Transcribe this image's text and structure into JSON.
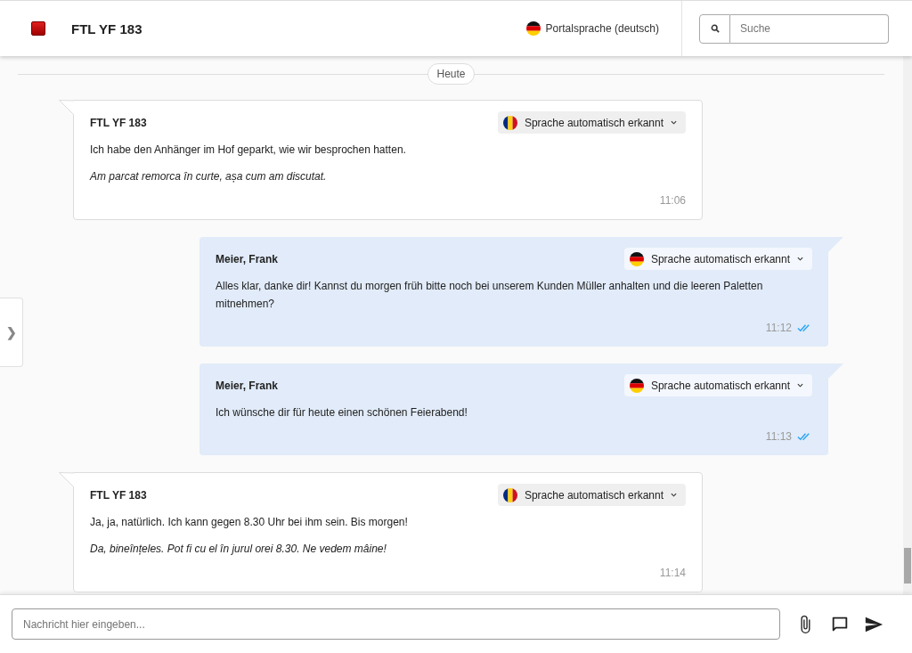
{
  "header": {
    "title": "FTL YF 183",
    "portal_language": {
      "label": "Portalsprache (deutsch)",
      "flag": {
        "kind": "de"
      }
    },
    "search": {
      "placeholder": "Suche"
    }
  },
  "date_divider": "Heute",
  "messages": [
    {
      "kind": "incoming",
      "sender": "FTL YF 183",
      "language": {
        "label": "Sprache automatisch erkannt",
        "flag": {
          "kind": "ro"
        }
      },
      "text": "Ich habe den Anhänger im Hof geparkt, wie wir besprochen hatten.",
      "translation": "Am parcat remorca în curte, așa cum am discutat.",
      "time": "11:06"
    },
    {
      "kind": "outgoing",
      "sender": "Meier, Frank",
      "language": {
        "label": "Sprache automatisch erkannt",
        "flag": {
          "kind": "de"
        }
      },
      "text": "Alles klar, danke dir! Kannst du morgen früh bitte noch bei unserem Kunden Müller anhalten und die leeren Paletten mitnehmen?",
      "time": "11:12",
      "read": true
    },
    {
      "kind": "outgoing",
      "sender": "Meier, Frank",
      "language": {
        "label": "Sprache automatisch erkannt",
        "flag": {
          "kind": "de"
        }
      },
      "text": "Ich wünsche dir für heute einen schönen Feierabend!",
      "time": "11:13",
      "read": true
    },
    {
      "kind": "incoming",
      "sender": "FTL YF 183",
      "language": {
        "label": "Sprache automatisch erkannt",
        "flag": {
          "kind": "ro"
        }
      },
      "text": "Ja, ja, natürlich. Ich kann gegen 8.30 Uhr bei ihm sein. Bis morgen!",
      "translation": "Da, bineînțeles. Pot fi cu el în jurul orei 8.30. Ne vedem mâine!",
      "time": "11:14"
    }
  ],
  "side_toggle": "❯",
  "composer": {
    "placeholder": "Nachricht hier eingeben..."
  }
}
